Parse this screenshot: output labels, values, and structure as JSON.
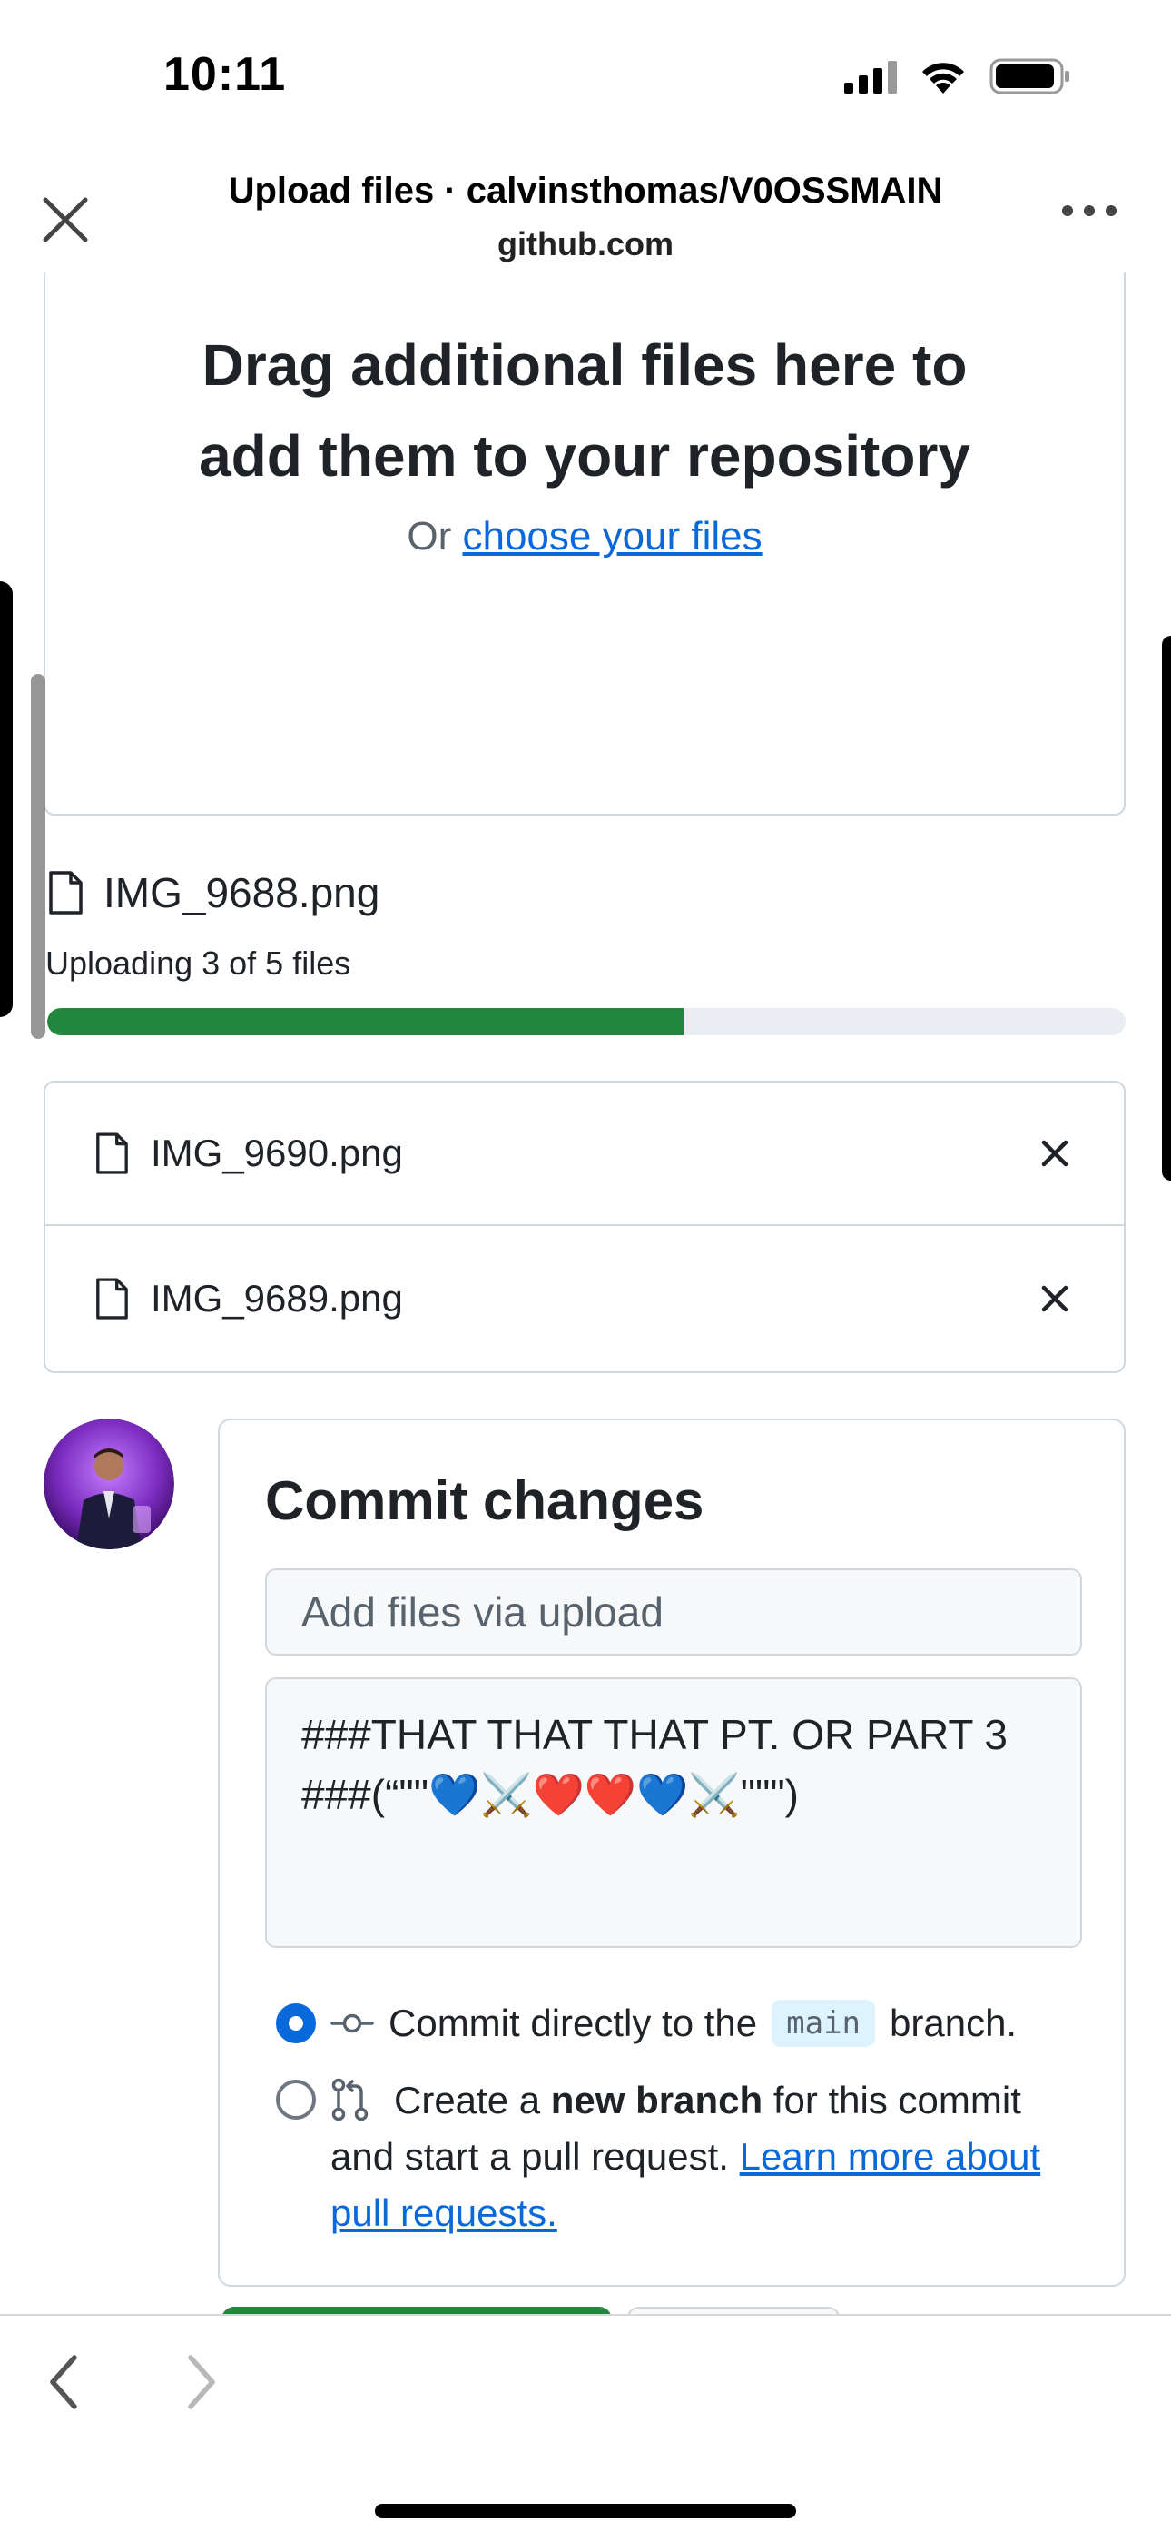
{
  "status_bar": {
    "time": "10:11"
  },
  "header": {
    "title": "Upload files · calvinsthomas/V0OSSMAIN",
    "domain": "github.com"
  },
  "dropzone": {
    "title_line1": "Drag additional files here to",
    "title_line2": "add them to your repository",
    "or_text": "Or ",
    "choose_link": "choose your files"
  },
  "upload": {
    "current_file": "IMG_9688.png",
    "status": "Uploading 3 of 5 files",
    "progress_percent": 59
  },
  "queued_files": [
    {
      "name": "IMG_9690.png"
    },
    {
      "name": "IMG_9689.png"
    }
  ],
  "commit": {
    "title": "Commit changes",
    "summary_placeholder": "Add files via upload",
    "description_line1": "###THAT THAT THAT PT. OR PART 3",
    "description_line2": "###(“\"\"💙⚔️❤️❤️💙⚔️\"\"\")",
    "option_direct_prefix": "Commit directly to the",
    "option_direct_branch": "main",
    "option_direct_suffix": "branch.",
    "option_new_prefix": "Create a ",
    "option_new_bold": "new branch",
    "option_new_suffix": " for this commit and start a pull request. ",
    "option_new_link": "Learn more about pull requests."
  },
  "colors": {
    "accent_blue": "#0969da",
    "progress_green": "#1f883d",
    "border": "#d0d7de"
  },
  "icons": [
    "close-icon",
    "more-icon",
    "file-icon",
    "remove-icon",
    "commit-icon",
    "pull-request-icon",
    "back-icon",
    "forward-icon"
  ]
}
